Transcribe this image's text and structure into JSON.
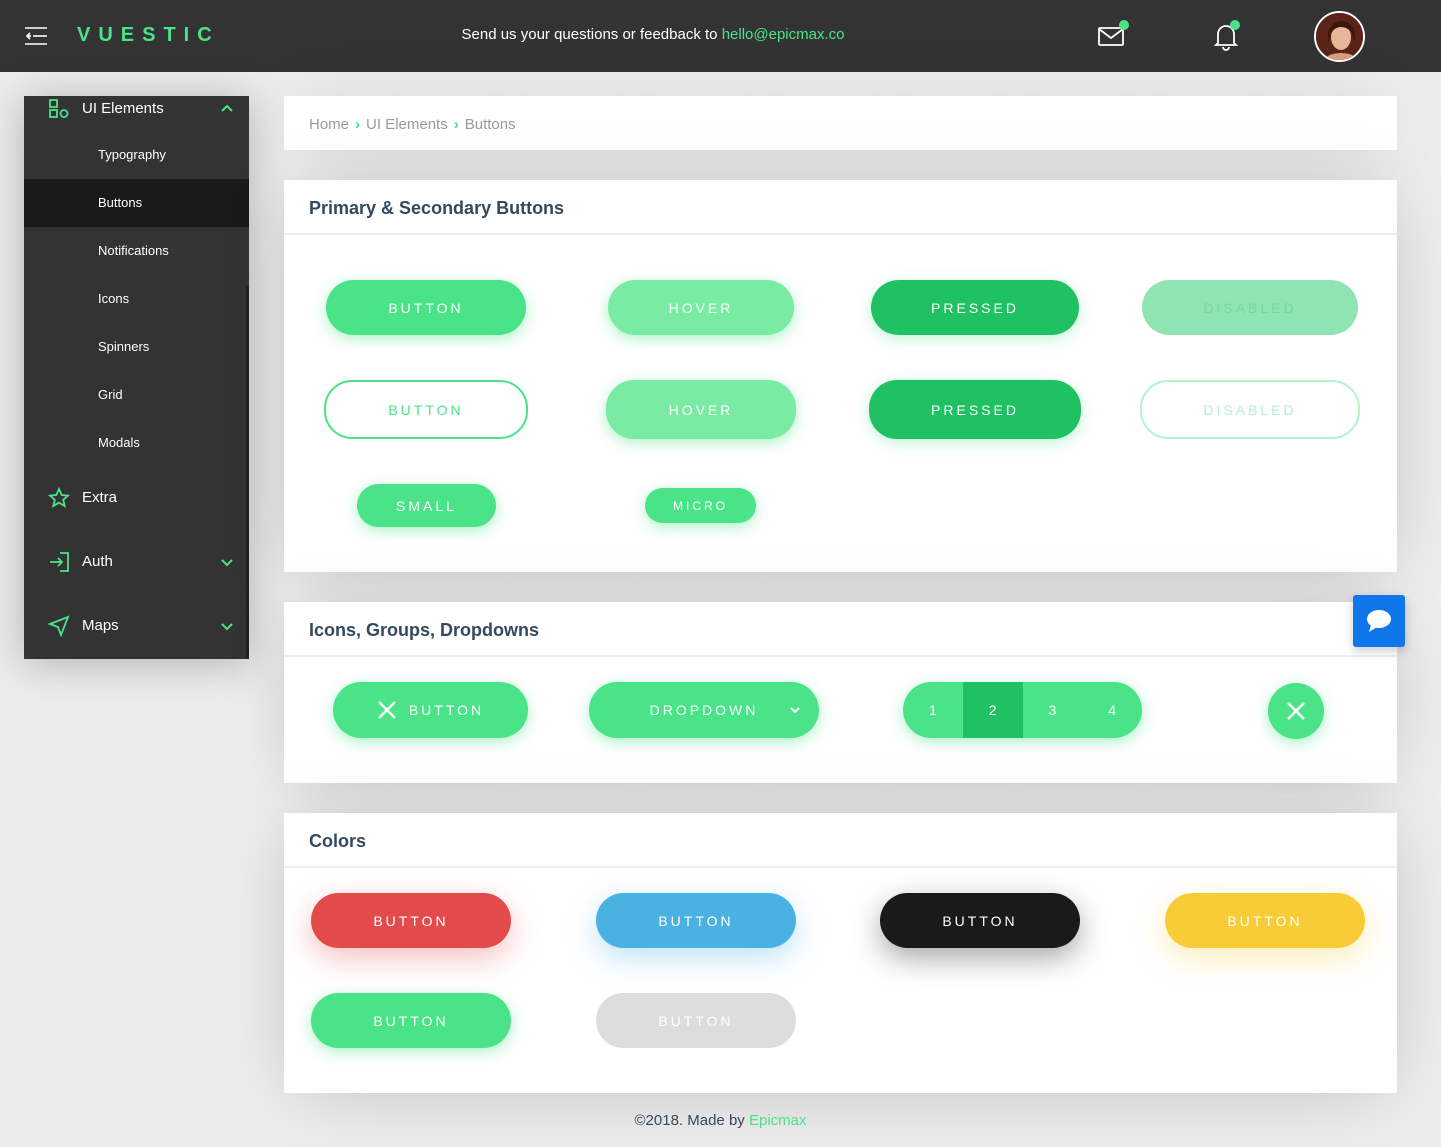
{
  "header": {
    "brand": "VUESTIC",
    "feedback_text": "Send us your questions or feedback to ",
    "feedback_email": "hello@epicmax.co",
    "icons": [
      "menu-toggle-icon",
      "mail-icon",
      "bell-icon"
    ]
  },
  "sidebar": {
    "group_ui": "UI Elements",
    "items": [
      "Typography",
      "Buttons",
      "Notifications",
      "Icons",
      "Spinners",
      "Grid",
      "Modals"
    ],
    "extra": "Extra",
    "auth": "Auth",
    "maps": "Maps"
  },
  "breadcrumb": {
    "home": "Home",
    "ui": "UI Elements",
    "current": "Buttons"
  },
  "primary_card": {
    "title": "Primary & Secondary Buttons",
    "button": "Button",
    "hover": "Hover",
    "pressed": "Pressed",
    "disabled": "Disabled",
    "small": "Small",
    "micro": "Micro"
  },
  "icons_card": {
    "title": "Icons, Groups, Dropdowns",
    "button": "Button",
    "dropdown": "Dropdown",
    "pages": [
      "1",
      "2",
      "3",
      "4"
    ]
  },
  "colors_card": {
    "title": "Colors",
    "button": "Button",
    "colors": {
      "danger": "#e34a4a",
      "info": "#4ab2e3",
      "dark": "#1a1a1a",
      "warning": "#f7cc36",
      "success": "#4ae387",
      "gray": "#dddddd"
    }
  },
  "footer": {
    "text": "©2018. Made by ",
    "link": "Epicmax"
  }
}
